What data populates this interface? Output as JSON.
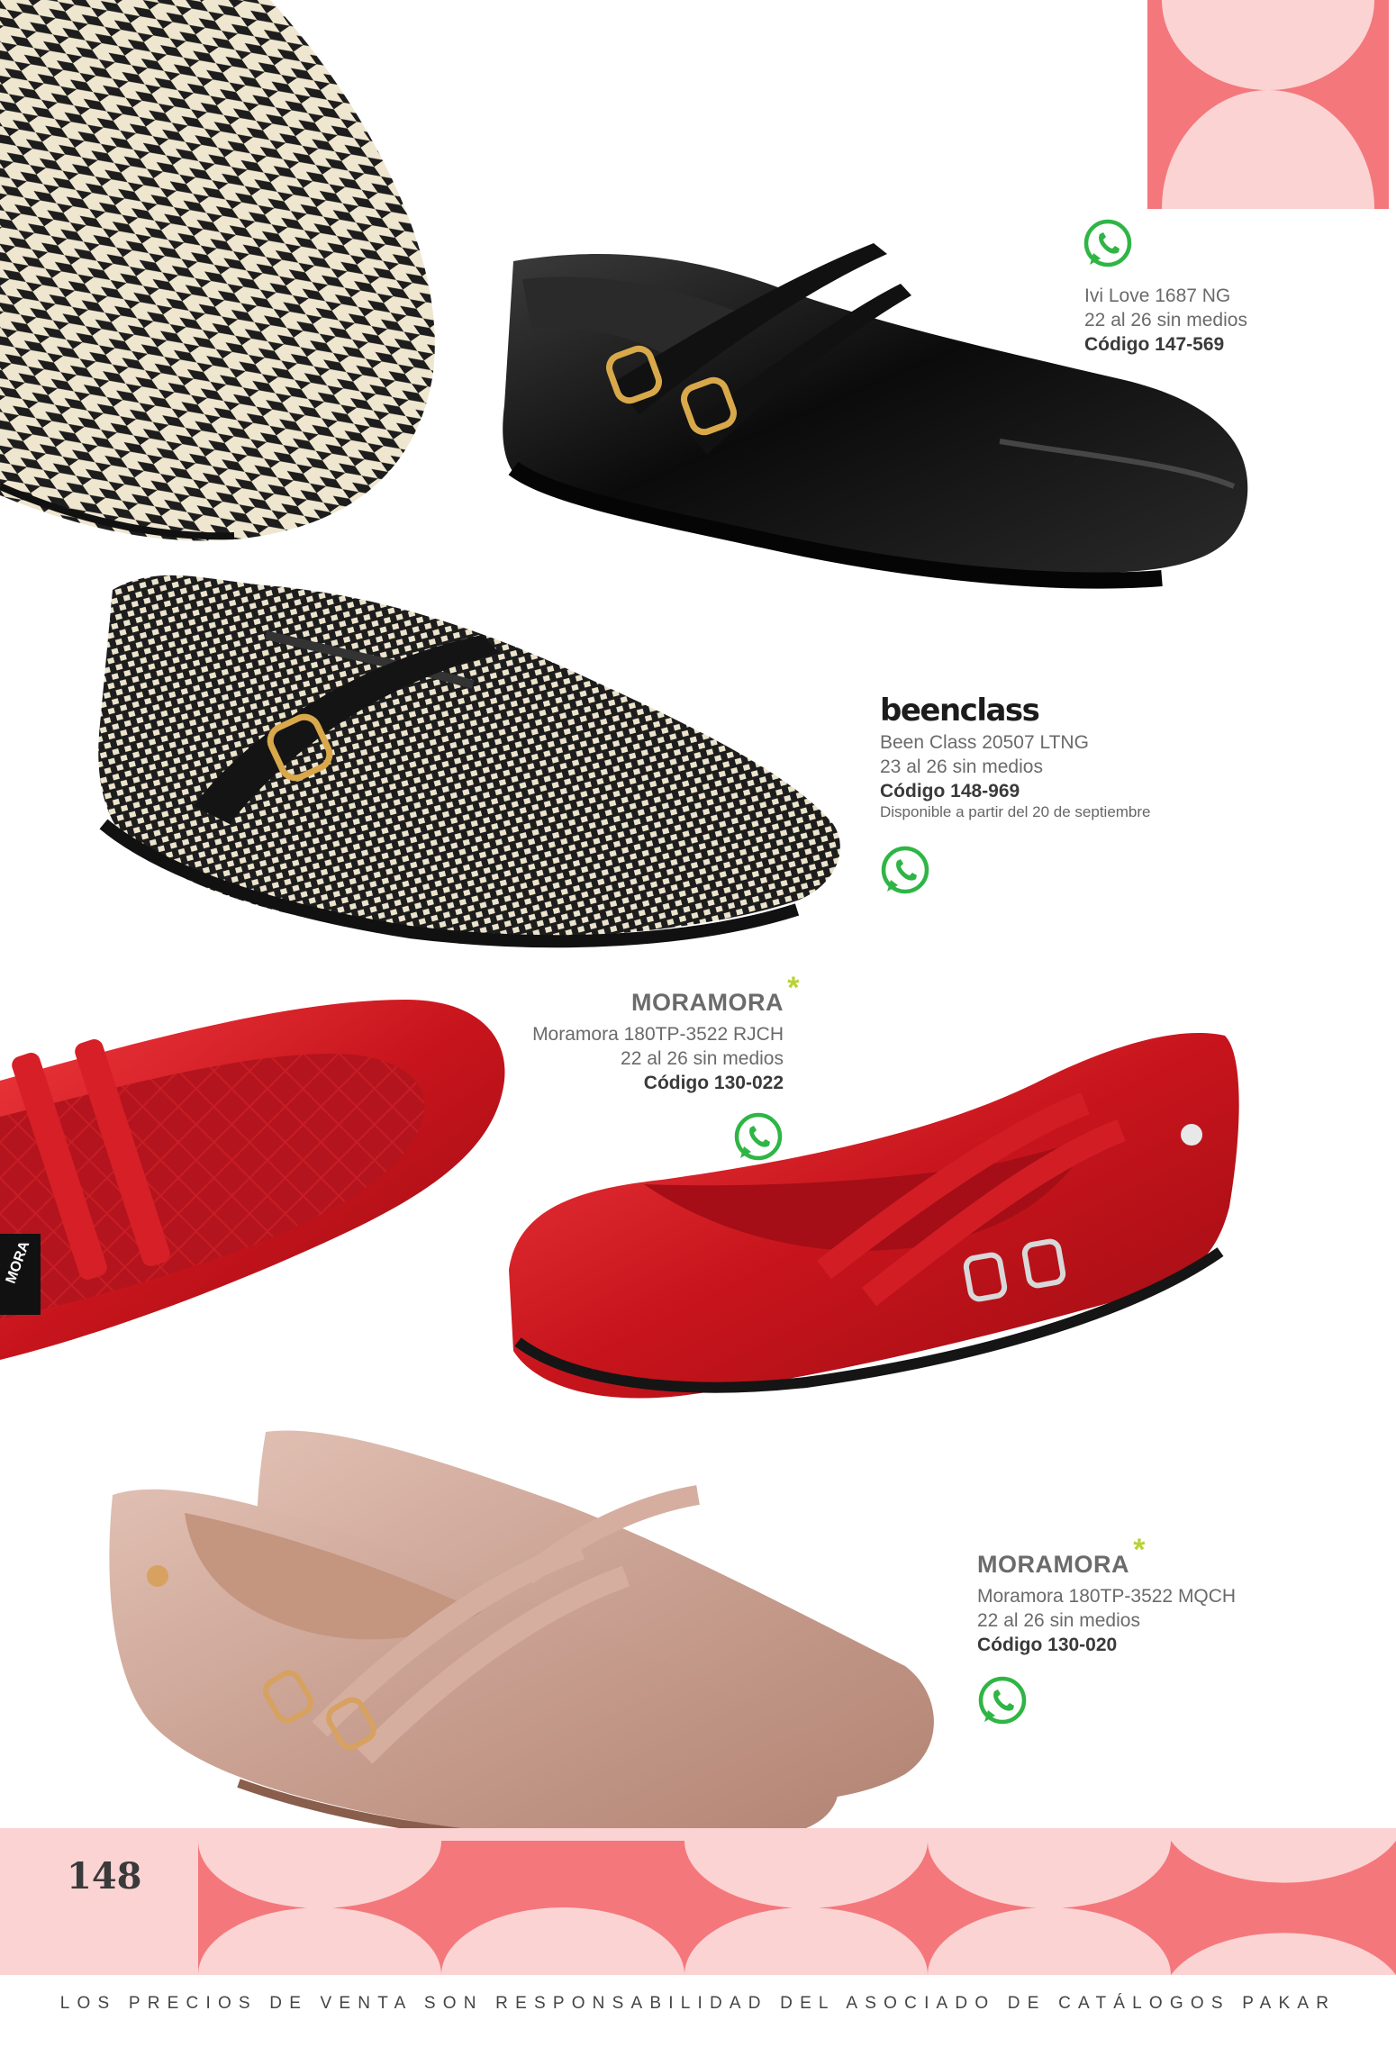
{
  "products": [
    {
      "brand": "",
      "name": "Ivi Love 1687 NG",
      "sizes": "22 al 26 sin medios",
      "code": "Código 147-569"
    },
    {
      "brand": "beenclass",
      "name": "Been Class 20507 LTNG",
      "sizes": "23 al 26 sin medios",
      "code": "Código 148-969",
      "availability": "Disponible a partir del 20 de septiembre"
    },
    {
      "brand": "MORAMORA",
      "name": "Moramora 180TP-3522 RJCH",
      "sizes": "22 al 26 sin medios",
      "code": "Código 130-022"
    },
    {
      "brand": "MORAMORA",
      "name": "Moramora 180TP-3522 MQCH",
      "sizes": "22 al 26 sin medios",
      "code": "Código 130-020"
    }
  ],
  "insole_text": "MORA",
  "page_number": "148",
  "footer_note": "LOS PRECIOS DE VENTA SON RESPONSABILIDAD DEL ASOCIADO DE CATÁLOGOS PAKAR",
  "colors": {
    "accent_pink": "#f4777c",
    "light_pink": "#fbd3d3",
    "whatsapp_green": "#2fb545",
    "brand_star": "#b7d334"
  },
  "icons": [
    "whatsapp-icon",
    "brand-star-icon"
  ]
}
